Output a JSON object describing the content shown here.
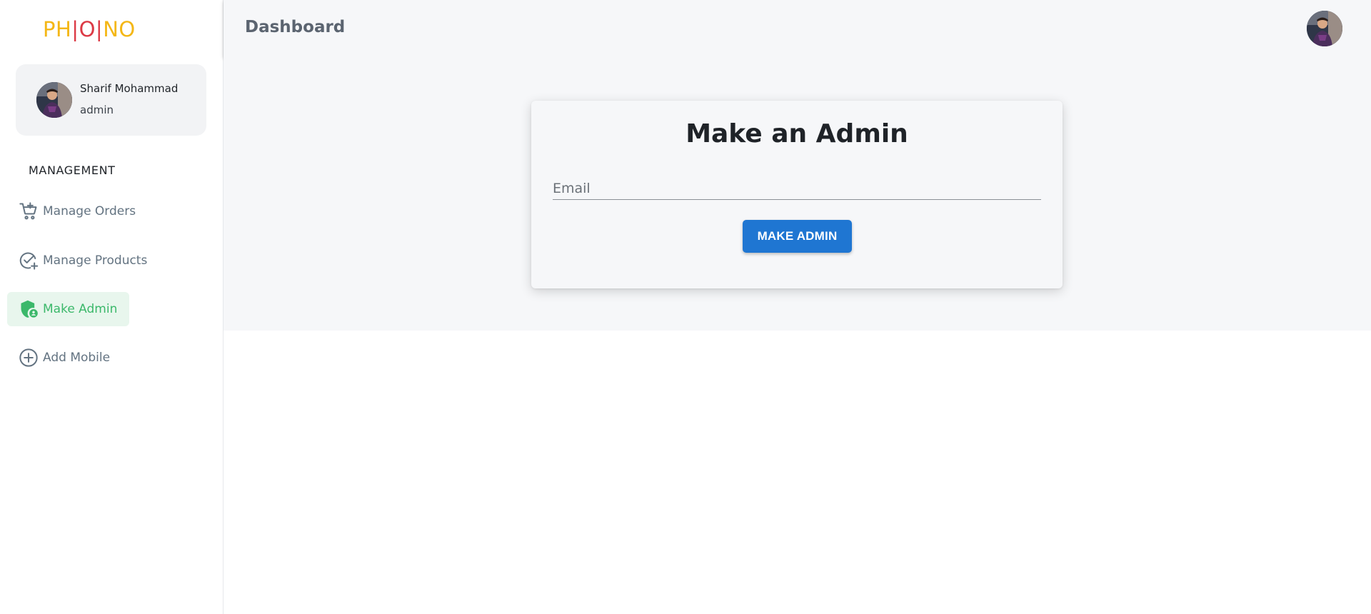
{
  "brand": {
    "part1": "PH",
    "sep1": "|",
    "part2": "O",
    "sep2": "|",
    "part3": "NO"
  },
  "user": {
    "name": "Sharif Mohammad",
    "role": "admin"
  },
  "sidebar": {
    "section_title": "MANAGEMENT",
    "items": [
      {
        "label": "Manage Orders",
        "icon": "cart-add-icon",
        "active": false
      },
      {
        "label": "Manage Products",
        "icon": "check-add-icon",
        "active": false
      },
      {
        "label": "Make Admin",
        "icon": "shield-account-icon",
        "active": true
      },
      {
        "label": "Add Mobile",
        "icon": "add-circle-icon",
        "active": false
      }
    ]
  },
  "header": {
    "title": "Dashboard"
  },
  "form": {
    "title": "Make an Admin",
    "email_value": "",
    "email_placeholder": "Email",
    "submit_label": "MAKE ADMIN"
  },
  "colors": {
    "brand_yellow": "#f4b716",
    "brand_red": "#dc3a45",
    "active_green": "#3bb86a",
    "button_blue": "#1f76d2"
  }
}
